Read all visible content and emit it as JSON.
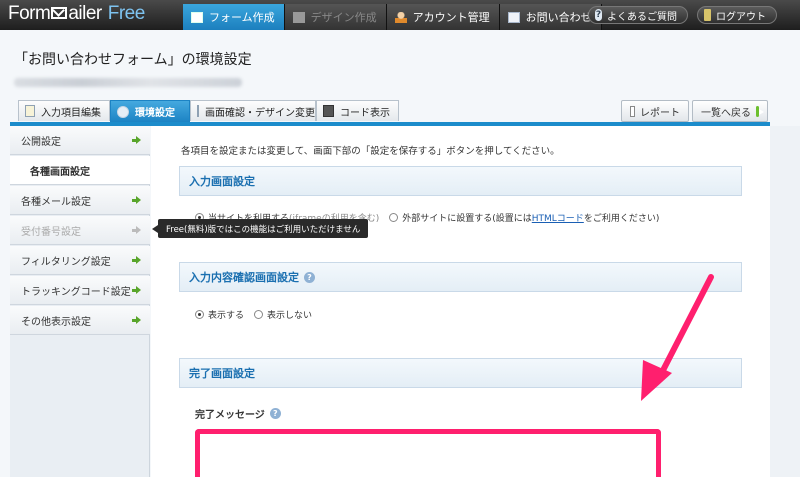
{
  "header": {
    "logo_main": "Form",
    "logo_mid": "ailer",
    "logo_free": "Free",
    "nav": [
      {
        "label": "フォーム作成",
        "icon": "form-icon",
        "state": "active"
      },
      {
        "label": "デザイン作成",
        "icon": "design-icon",
        "state": "disabled"
      },
      {
        "label": "アカウント管理",
        "icon": "user-icon",
        "state": "normal"
      },
      {
        "label": "お問い合わせ",
        "icon": "mail-icon",
        "state": "normal"
      }
    ],
    "faq_label": "よくあるご質問",
    "faq_icon_glyph": "?",
    "logout_label": "ログアウト"
  },
  "page": {
    "title": "「お問い合わせフォーム」の環境設定"
  },
  "tabs": [
    {
      "label": "入力項目編集",
      "state": "normal"
    },
    {
      "label": "環境設定",
      "state": "active"
    },
    {
      "label": "画面確認・デザイン変更",
      "state": "normal"
    },
    {
      "label": "コード表示",
      "state": "normal"
    }
  ],
  "actions": {
    "report_label": "レポート",
    "back_label": "一覧へ戻る"
  },
  "sidebar": {
    "items": [
      {
        "label": "公開設定",
        "state": "normal"
      },
      {
        "label": "各種画面設定",
        "state": "active"
      },
      {
        "label": "各種メール設定",
        "state": "normal"
      },
      {
        "label": "受付番号設定",
        "state": "disabled"
      },
      {
        "label": "フィルタリング設定",
        "state": "normal"
      },
      {
        "label": "トラッキングコード設定",
        "state": "normal"
      },
      {
        "label": "その他表示設定",
        "state": "normal"
      }
    ]
  },
  "tooltip": {
    "text": "Free(無料)版ではこの機能はご利用いただけません"
  },
  "main": {
    "intro": "各項目を設定または変更して、画面下部の「設定を保存する」ボタンを押してください。",
    "help_glyph": "?",
    "sections": {
      "input_screen": {
        "title": "入力画面設定",
        "option1_label": "当サイトを利用する",
        "option1_note": "(iframeの利用を含む)",
        "option2_label": "外部サイトに設置する",
        "option2_note_pre": "(設置には",
        "option2_note_link": "HTMLコード",
        "option2_note_post": "をご利用ください)"
      },
      "confirm_screen": {
        "title": "入力内容確認画面設定",
        "show_label": "表示する",
        "hide_label": "表示しない"
      },
      "complete_screen": {
        "title": "完了画面設定",
        "message_label": "完了メッセージ"
      }
    }
  },
  "colors": {
    "accent_blue": "#1c8ccb",
    "highlight_pink": "#ff1f6e",
    "section_title": "#1a6fb0"
  }
}
